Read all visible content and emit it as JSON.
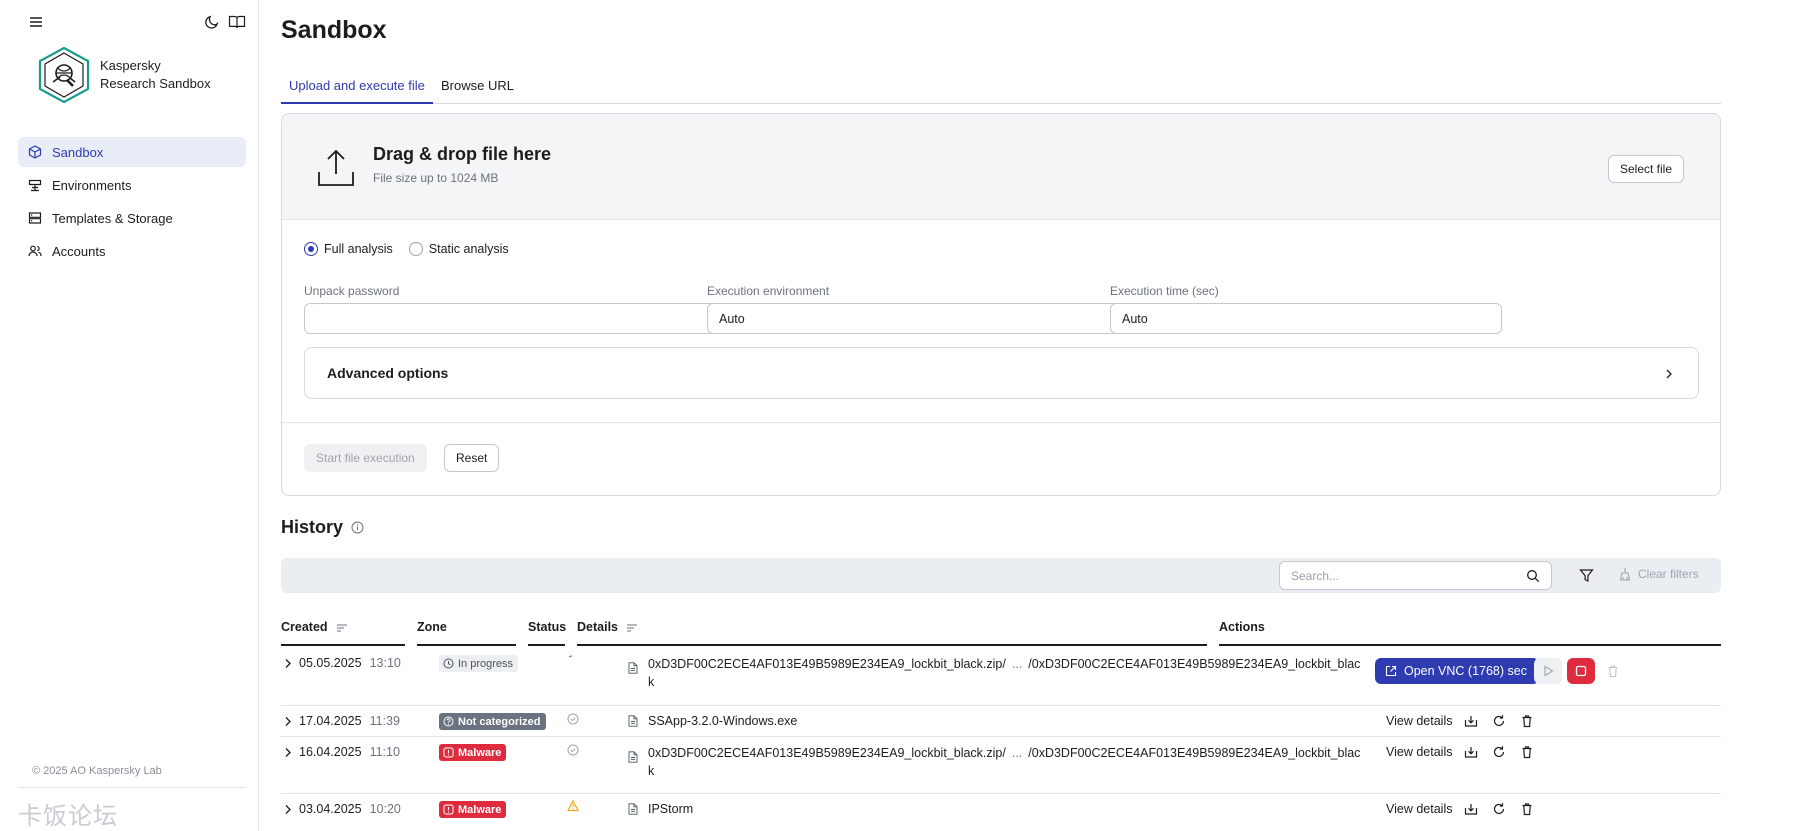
{
  "sidebar": {
    "brand_line1": "Kaspersky",
    "brand_line2": "Research Sandbox",
    "items": [
      {
        "label": "Sandbox",
        "icon": "cube-icon",
        "active": true
      },
      {
        "label": "Environments",
        "icon": "environments-icon",
        "active": false
      },
      {
        "label": "Templates & Storage",
        "icon": "storage-icon",
        "active": false
      },
      {
        "label": "Accounts",
        "icon": "users-icon",
        "active": false
      }
    ],
    "copyright": "© 2025 AO Kaspersky Lab",
    "watermark": "卡饭论坛"
  },
  "page": {
    "title": "Sandbox",
    "tabs": [
      "Upload and execute file",
      "Browse URL"
    ]
  },
  "upload": {
    "title": "Drag & drop file here",
    "subtitle": "File size up to 1024 MB",
    "select_label": "Select file",
    "analysis_options": [
      "Full analysis",
      "Static analysis"
    ],
    "selected_analysis": "Full analysis",
    "fields": {
      "password_label": "Unpack password",
      "password_value": "",
      "env_label": "Execution environment",
      "env_value": "Auto",
      "time_label": "Execution time (sec)",
      "time_value": "Auto"
    },
    "advanced_label": "Advanced options",
    "start_label": "Start file execution",
    "reset_label": "Reset"
  },
  "history": {
    "title": "History",
    "search_placeholder": "Search...",
    "clear_filters": "Clear filters",
    "columns": [
      "Created",
      "Zone",
      "Status",
      "Details",
      "Actions"
    ],
    "rows": [
      {
        "date": "05.05.2025",
        "time": "13:10",
        "zone": "In progress",
        "zone_type": "in-progress",
        "status": "running",
        "details_line1": "0xD3DF00C2ECE4AF013E49B5989E234EA9_lockbit_black.zip/",
        "details_ellipsis": "...",
        "details_path": "/0xD3DF00C2ECE4AF013E49B5989E234EA9_lockbit_blac",
        "details_line2": "k",
        "action": "Open VNC (1768) sec"
      },
      {
        "date": "17.04.2025",
        "time": "11:39",
        "zone": "Not categorized",
        "zone_type": "not-categorized",
        "status": "done",
        "details_line1": "SSApp-3.2.0-Windows.exe",
        "action": "View details"
      },
      {
        "date": "16.04.2025",
        "time": "11:10",
        "zone": "Malware",
        "zone_type": "malware",
        "status": "done",
        "details_line1": "0xD3DF00C2ECE4AF013E49B5989E234EA9_lockbit_black.zip/",
        "details_ellipsis": "...",
        "details_path": "/0xD3DF00C2ECE4AF013E49B5989E234EA9_lockbit_blac",
        "details_line2": "k",
        "action": "View details"
      },
      {
        "date": "03.04.2025",
        "time": "10:20",
        "zone": "Malware",
        "zone_type": "malware",
        "status": "warning",
        "details_line1": "IPStorm",
        "action": "View details"
      }
    ]
  },
  "colors": {
    "accent": "#2f3bb0",
    "malware": "#de2c3e",
    "not_categorized": "#6b7280",
    "in_progress_bg": "#eceef1",
    "warning": "#f0a500"
  }
}
